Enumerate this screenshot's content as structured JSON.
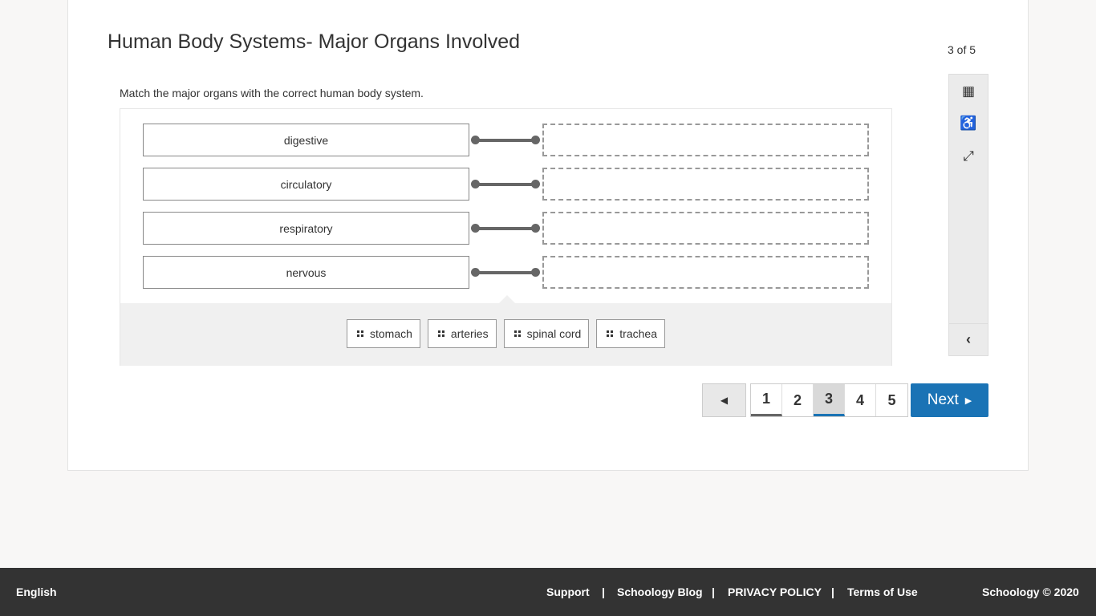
{
  "title": "Human Body Systems- Major Organs Involved",
  "progress": "3 of 5",
  "prompt": "Match the major organs with the correct human body system.",
  "stems": [
    "digestive",
    "circulatory",
    "respiratory",
    "nervous"
  ],
  "choices": [
    "stomach",
    "arteries",
    "spinal cord",
    "trachea"
  ],
  "pager": {
    "prev": "◀",
    "pages": [
      "1",
      "2",
      "3",
      "4",
      "5"
    ],
    "current": "3",
    "next": "Next",
    "next_icon": "▶"
  },
  "tools": {
    "calendar": "▦",
    "accessibility": "♿",
    "fullscreen": "⤢",
    "collapse": "‹"
  },
  "footer": {
    "language": "English",
    "links": [
      "Support",
      "Schoology Blog",
      "PRIVACY POLICY",
      "Terms of Use"
    ],
    "separator": "|",
    "copyright": "Schoology © 2020"
  }
}
